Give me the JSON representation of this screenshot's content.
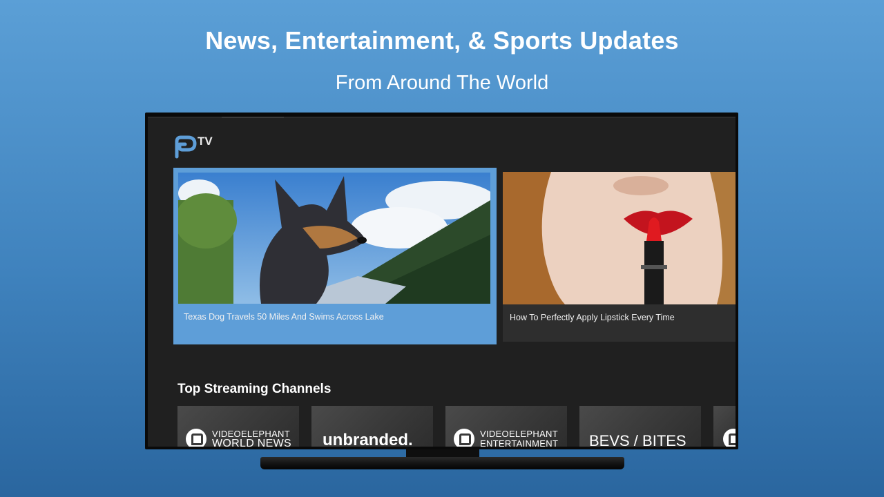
{
  "promo": {
    "headline": "News, Entertainment, & Sports Updates",
    "subheadline": "From Around The World"
  },
  "app": {
    "logo_text": "TV",
    "accent_color": "#5e9ed8"
  },
  "featured": [
    {
      "title": "Texas Dog Travels 50 Miles And Swims Across Lake",
      "focused": true
    },
    {
      "title": "How To Perfectly Apply Lipstick Every Time",
      "focused": false
    }
  ],
  "channels_section": {
    "title": "Top Streaming Channels",
    "channels": [
      {
        "line1": "VIDEOELEPHANT",
        "line2": "WORLD NEWS"
      },
      {
        "line1": "unbranded."
      },
      {
        "line1": "VIDEOELEPHANT",
        "line2": "ENTERTAINMENT"
      },
      {
        "line1": "BEVS / BITES"
      },
      {
        "line1": ""
      }
    ]
  }
}
